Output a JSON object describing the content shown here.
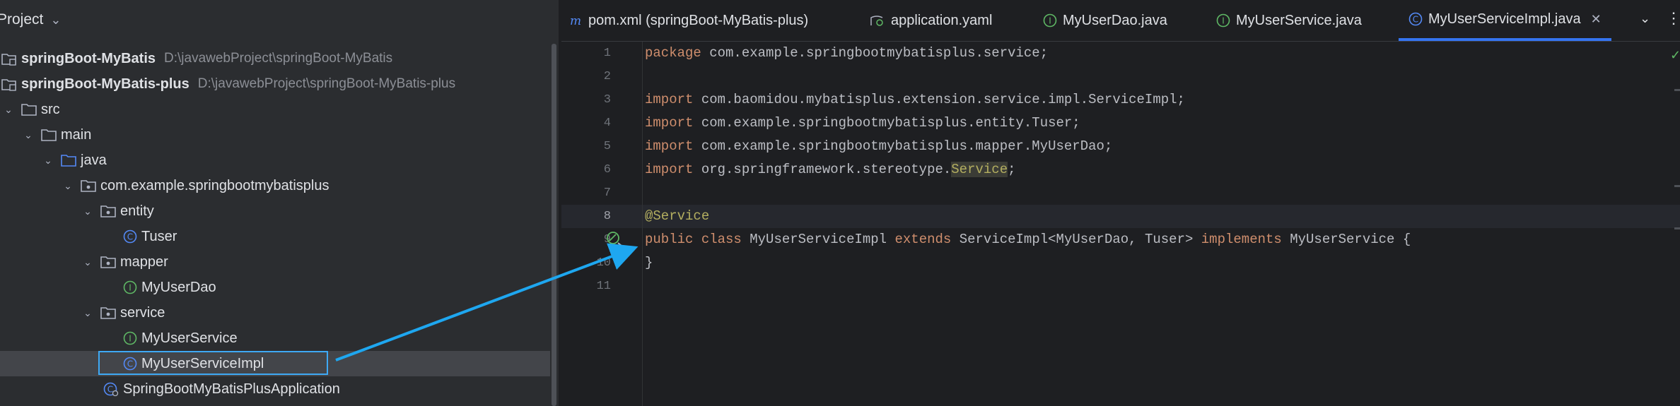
{
  "project": {
    "title": "Project"
  },
  "tree": {
    "items": [
      {
        "label": "springBoot-MyBatis",
        "path": "D:\\javawebProject\\springBoot-MyBatis"
      },
      {
        "label": "springBoot-MyBatis-plus",
        "path": "D:\\javawebProject\\springBoot-MyBatis-plus"
      },
      {
        "label": "src"
      },
      {
        "label": "main"
      },
      {
        "label": "java"
      },
      {
        "label": "com.example.springbootmybatisplus"
      },
      {
        "label": "entity"
      },
      {
        "label": "Tuser"
      },
      {
        "label": "mapper"
      },
      {
        "label": "MyUserDao"
      },
      {
        "label": "service"
      },
      {
        "label": "MyUserService"
      },
      {
        "label": "MyUserServiceImpl"
      },
      {
        "label": "SpringBootMyBatisPlusApplication"
      }
    ]
  },
  "tabs": [
    {
      "label": "pom.xml (springBoot-MyBatis-plus)"
    },
    {
      "label": "application.yaml"
    },
    {
      "label": "MyUserDao.java"
    },
    {
      "label": "MyUserService.java"
    },
    {
      "label": "MyUserServiceImpl.java"
    }
  ],
  "editor": {
    "line_numbers": [
      "1",
      "2",
      "3",
      "4",
      "5",
      "6",
      "7",
      "8",
      "9",
      "10",
      "11"
    ],
    "lines": {
      "l1_kw": "package",
      "l1_rest": " com.example.springbootmybatisplus.service;",
      "l3_kw": "import",
      "l3_rest": " com.baomidou.mybatisplus.extension.service.impl.ServiceImpl;",
      "l4_kw": "import",
      "l4_rest": " com.example.springbootmybatisplus.entity.Tuser;",
      "l5_kw": "import",
      "l5_rest": " com.example.springbootmybatisplus.mapper.MyUserDao;",
      "l6_kw": "import",
      "l6_a": " org.springframework.stereotype.",
      "l6_hl": "Service",
      "l6_b": ";",
      "l8_ann": "@Service",
      "l9_kw1": "public",
      "l9_sp1": " ",
      "l9_kw2": "class",
      "l9_a": " MyUserServiceImpl ",
      "l9_kw3": "extends",
      "l9_b": " ServiceImpl<MyUserDao, Tuser> ",
      "l9_kw4": "implements",
      "l9_c": " MyUserService {",
      "l10": "}"
    }
  },
  "colors": {
    "accent": "#3574f0",
    "arrow": "#1ea7f0",
    "keyword": "#cf8e6d",
    "annotation": "#b3ae60"
  }
}
